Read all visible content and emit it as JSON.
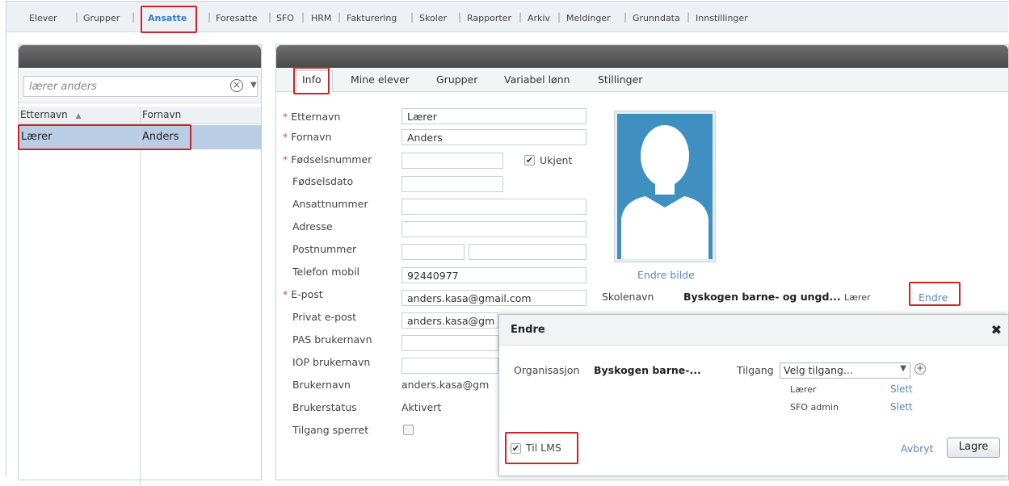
{
  "nav": {
    "items": [
      "Elever",
      "Grupper",
      "Ansatte",
      "Foresatte",
      "SFO",
      "HRM",
      "Fakturering",
      "Skoler",
      "Rapporter",
      "Arkiv",
      "Meldinger",
      "Grunndata",
      "Innstillinger"
    ],
    "active": "Ansatte"
  },
  "left": {
    "search_value": "lærer anders",
    "col_etternavn": "Etternavn",
    "col_fornavn": "Fornavn",
    "sort_icon": "▲",
    "row": {
      "etternavn": "Lærer",
      "fornavn": "Anders"
    }
  },
  "tabs": [
    "Info",
    "Mine elever",
    "Grupper",
    "Variabel lønn",
    "Stillinger"
  ],
  "form": {
    "etternavn_label": "Etternavn",
    "etternavn": "Lærer",
    "fornavn_label": "Fornavn",
    "fornavn": "Anders",
    "fodselsnummer_label": "Fødselsnummer",
    "ukjent_label": "Ukjent",
    "fodselsdato_label": "Fødselsdato",
    "ansattnummer_label": "Ansattnummer",
    "adresse_label": "Adresse",
    "postnummer_label": "Postnummer",
    "telefon_label": "Telefon mobil",
    "telefon": "92440977",
    "epost_label": "E-post",
    "epost": "anders.kasa@gmail.com",
    "privat_epost_label": "Privat e-post",
    "privat_epost": "anders.kasa@gm",
    "pas_label": "PAS brukernavn",
    "iop_label": "IOP brukernavn",
    "brukernavn_label": "Brukernavn",
    "brukernavn": "anders.kasa@gm",
    "brukerstatus_label": "Brukerstatus",
    "brukerstatus": "Aktivert",
    "sperret_label": "Tilgang sperret"
  },
  "profile": {
    "endre_bilde": "Endre bilde",
    "skolenavn_label": "Skolenavn",
    "skolenavn": "Byskogen barne- og ungd...",
    "rolle": "Lærer",
    "endre": "Endre"
  },
  "dialog": {
    "title": "Endre",
    "org_label": "Organisasjon",
    "org_value": "Byskogen barne-...",
    "tilgang_label": "Tilgang",
    "tilgang_placeholder": "Velg tilgang...",
    "roles": [
      {
        "name": "Lærer",
        "action": "Slett"
      },
      {
        "name": "SFO admin",
        "action": "Slett"
      }
    ],
    "til_lms": "Til LMS",
    "avbryt": "Avbryt",
    "lagre": "Lagre"
  }
}
